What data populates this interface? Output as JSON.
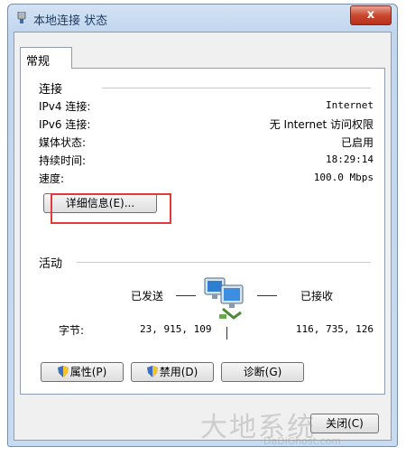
{
  "window": {
    "title": "本地连接 状态",
    "close_label": "x"
  },
  "tabs": [
    {
      "label": "常规"
    }
  ],
  "connection": {
    "heading": "连接",
    "rows": [
      {
        "label": "IPv4 连接:",
        "value": "Internet"
      },
      {
        "label": "IPv6 连接:",
        "value": "无 Internet 访问权限"
      },
      {
        "label": "媒体状态:",
        "value": "已启用"
      },
      {
        "label": "持续时间:",
        "value": "18:29:14"
      },
      {
        "label": "速度:",
        "value": "100.0 Mbps"
      }
    ],
    "details_button": "详细信息(E)..."
  },
  "activity": {
    "heading": "活动",
    "sent_label": "已发送",
    "received_label": "已接收",
    "bytes_label": "字节:",
    "bytes_sent": "23, 915, 109",
    "bytes_received": "116, 735, 126"
  },
  "buttons": {
    "properties": "属性(P)",
    "disable": "禁用(D)",
    "diagnose": "诊断(G)",
    "close": "关闭(C)"
  },
  "icons": {
    "title": "network-adapter-icon",
    "network": "network-computers-icon",
    "shield": "uac-shield-icon"
  },
  "colors": {
    "close_button": "#c9482f",
    "highlight": "#e03a3a",
    "title_bar": "#c2d6ee"
  },
  "watermark": {
    "brand": "大地系统",
    "url": "DaDiGhost.com"
  }
}
